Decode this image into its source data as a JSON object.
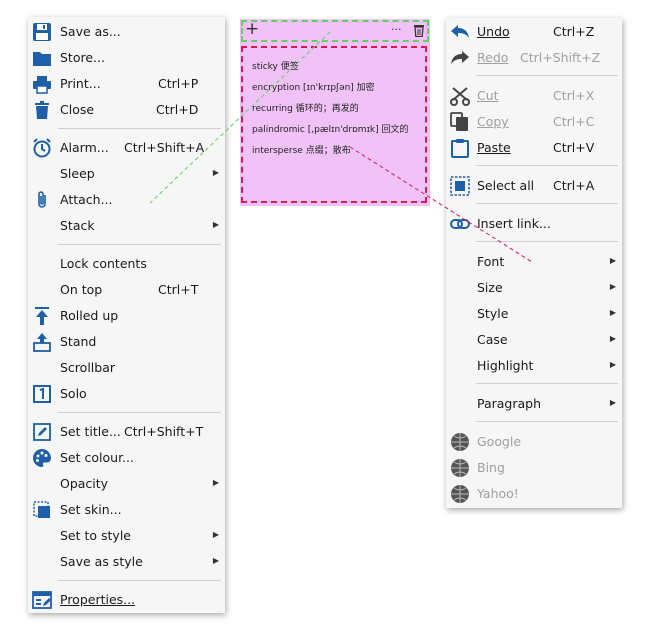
{
  "left_menu": {
    "items": [
      {
        "label": "Save as...",
        "shortcut": "",
        "icon": "save-icon",
        "arrow": false
      },
      {
        "label": "Store...",
        "shortcut": "",
        "icon": "folder-icon",
        "arrow": false
      },
      {
        "label": "Print...",
        "shortcut": "Ctrl+P",
        "icon": "printer-icon",
        "arrow": false
      },
      {
        "label": "Close",
        "shortcut": "Ctrl+D",
        "icon": "trash-icon",
        "arrow": false
      },
      {
        "label": "Alarm...",
        "shortcut": "Ctrl+Shift+A",
        "icon": "alarm-clock-icon",
        "arrow": false
      },
      {
        "label": "Sleep",
        "shortcut": "",
        "icon": "",
        "arrow": true
      },
      {
        "label": "Attach...",
        "shortcut": "",
        "icon": "paperclip-icon",
        "arrow": false
      },
      {
        "label": "Stack",
        "shortcut": "",
        "icon": "",
        "arrow": true
      },
      {
        "label": "Lock contents",
        "shortcut": "",
        "icon": "",
        "arrow": false
      },
      {
        "label": "On top",
        "shortcut": "Ctrl+T",
        "icon": "",
        "arrow": false
      },
      {
        "label": "Rolled up",
        "shortcut": "",
        "icon": "roll-up-icon",
        "arrow": false
      },
      {
        "label": "Stand",
        "shortcut": "",
        "icon": "stand-icon",
        "arrow": false
      },
      {
        "label": "Scrollbar",
        "shortcut": "",
        "icon": "",
        "arrow": false
      },
      {
        "label": "Solo",
        "shortcut": "",
        "icon": "solo-icon",
        "arrow": false
      },
      {
        "label": "Set title...",
        "shortcut": "Ctrl+Shift+T",
        "icon": "edit-title-icon",
        "arrow": false
      },
      {
        "label": "Set colour...",
        "shortcut": "",
        "icon": "palette-icon",
        "arrow": false
      },
      {
        "label": "Opacity",
        "shortcut": "",
        "icon": "",
        "arrow": true
      },
      {
        "label": "Set skin...",
        "shortcut": "",
        "icon": "skin-icon",
        "arrow": false
      },
      {
        "label": "Set to style",
        "shortcut": "",
        "icon": "",
        "arrow": true
      },
      {
        "label": "Save as style",
        "shortcut": "",
        "icon": "",
        "arrow": true
      },
      {
        "label": "Properties...",
        "shortcut": "",
        "icon": "properties-icon",
        "arrow": false
      }
    ]
  },
  "sticky_note": {
    "add_symbol": "+",
    "more_symbol": "···",
    "lines": [
      "sticky 便签",
      "encryption [ɪn'krɪpʃən] 加密",
      "recurring 循环的；再发的",
      "palindromic [,pælɪn'drɒmɪk] 回文的",
      "intersperse 点缀；散布"
    ]
  },
  "right_menu": {
    "items": [
      {
        "label": "Undo",
        "shortcut": "Ctrl+Z",
        "icon": "undo-icon",
        "arrow": false,
        "disabled": false
      },
      {
        "label": "Redo",
        "shortcut": "Ctrl+Shift+Z",
        "icon": "redo-icon",
        "arrow": false,
        "disabled": true
      },
      {
        "label": "Cut",
        "shortcut": "Ctrl+X",
        "icon": "scissors-icon",
        "arrow": false,
        "disabled": true
      },
      {
        "label": "Copy",
        "shortcut": "Ctrl+C",
        "icon": "copy-icon",
        "arrow": false,
        "disabled": true
      },
      {
        "label": "Paste",
        "shortcut": "Ctrl+V",
        "icon": "clipboard-icon",
        "arrow": false,
        "disabled": false
      },
      {
        "label": "Select all",
        "shortcut": "Ctrl+A",
        "icon": "select-all-icon",
        "arrow": false,
        "disabled": false
      },
      {
        "label": "Insert link...",
        "shortcut": "",
        "icon": "link-icon",
        "arrow": false,
        "disabled": false
      },
      {
        "label": "Font",
        "shortcut": "",
        "icon": "",
        "arrow": true,
        "disabled": false
      },
      {
        "label": "Size",
        "shortcut": "",
        "icon": "",
        "arrow": true,
        "disabled": false
      },
      {
        "label": "Style",
        "shortcut": "",
        "icon": "",
        "arrow": true,
        "disabled": false
      },
      {
        "label": "Case",
        "shortcut": "",
        "icon": "",
        "arrow": true,
        "disabled": false
      },
      {
        "label": "Highlight",
        "shortcut": "",
        "icon": "",
        "arrow": true,
        "disabled": false
      },
      {
        "label": "Paragraph",
        "shortcut": "",
        "icon": "",
        "arrow": true,
        "disabled": false
      },
      {
        "label": "Google",
        "shortcut": "",
        "icon": "globe-icon",
        "arrow": false,
        "disabled": true
      },
      {
        "label": "Bing",
        "shortcut": "",
        "icon": "globe-icon",
        "arrow": false,
        "disabled": true
      },
      {
        "label": "Yahoo!",
        "shortcut": "",
        "icon": "globe-icon",
        "arrow": false,
        "disabled": true
      }
    ]
  },
  "colors": {
    "icon_blue": "#1e5fa8",
    "note_background": "#f1c2f7",
    "toolbar_dash": "#5fcf5f",
    "body_dash": "#d21c55"
  }
}
